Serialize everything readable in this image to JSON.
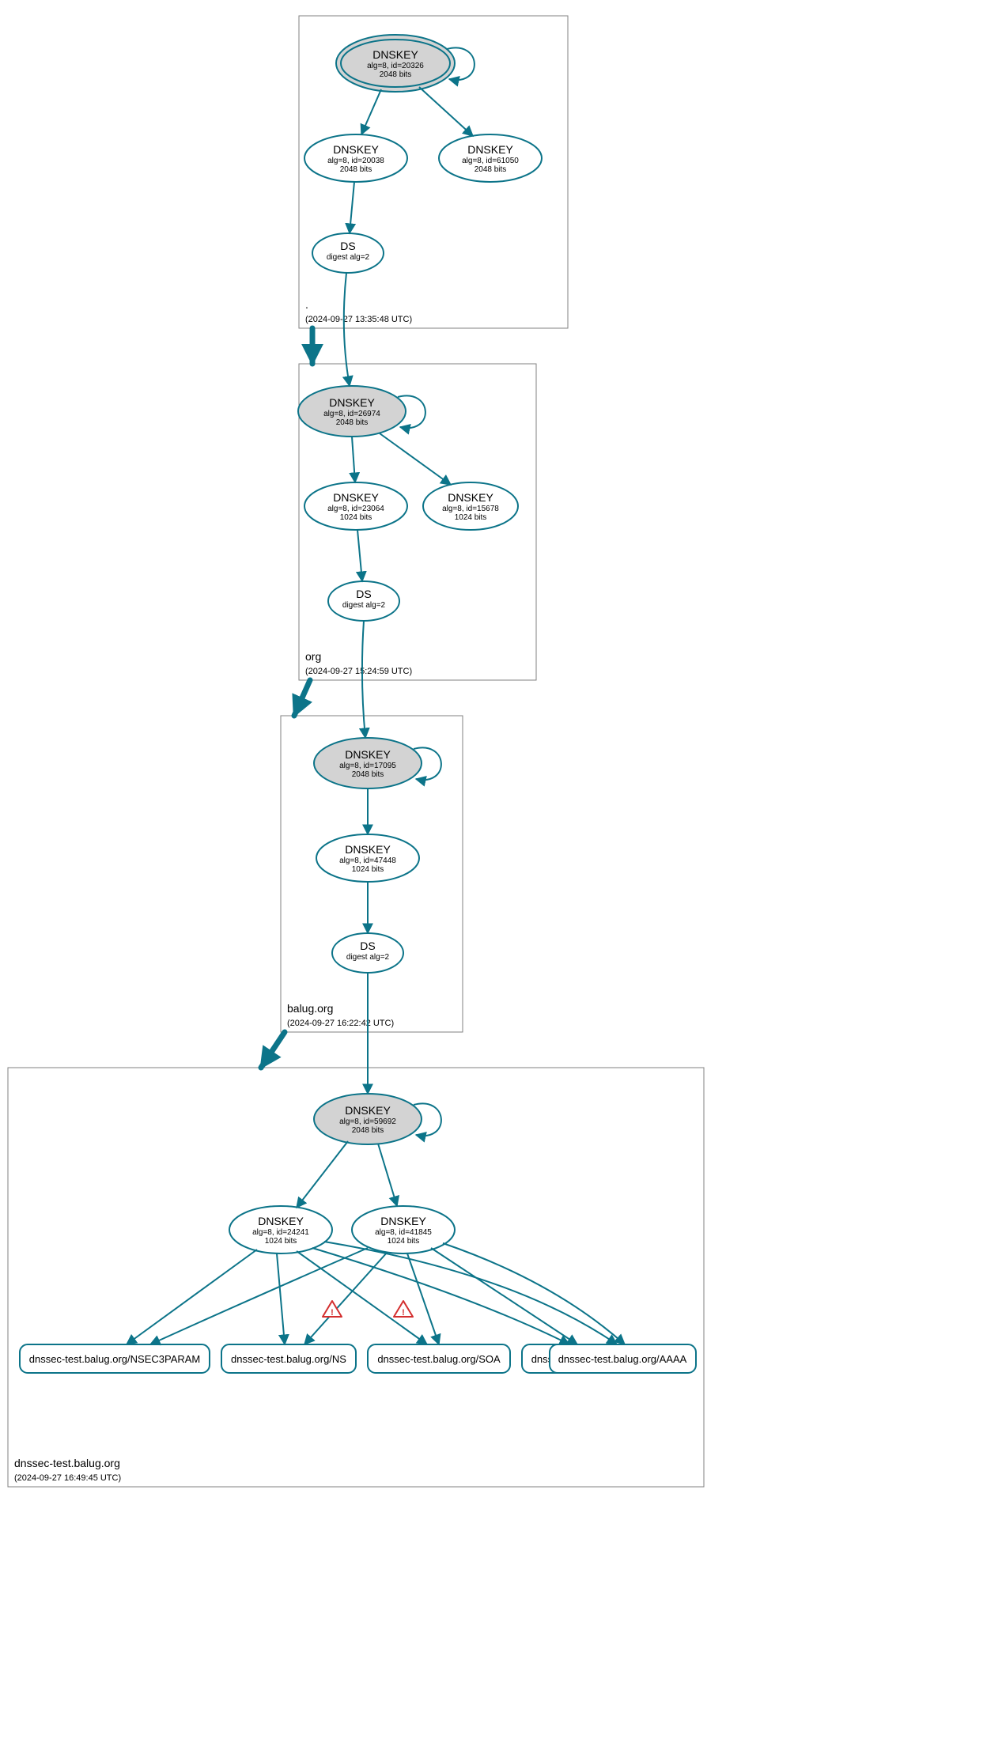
{
  "zones": {
    "root": {
      "label": ".",
      "timestamp": "(2024-09-27 13:35:48 UTC)",
      "keys": {
        "ksk": {
          "title": "DNSKEY",
          "line1": "alg=8, id=20326",
          "line2": "2048 bits"
        },
        "zsk1": {
          "title": "DNSKEY",
          "line1": "alg=8, id=20038",
          "line2": "2048 bits"
        },
        "zsk2": {
          "title": "DNSKEY",
          "line1": "alg=8, id=61050",
          "line2": "2048 bits"
        }
      },
      "ds": {
        "title": "DS",
        "line1": "digest alg=2"
      }
    },
    "org": {
      "label": "org",
      "timestamp": "(2024-09-27 15:24:59 UTC)",
      "keys": {
        "ksk": {
          "title": "DNSKEY",
          "line1": "alg=8, id=26974",
          "line2": "2048 bits"
        },
        "zsk1": {
          "title": "DNSKEY",
          "line1": "alg=8, id=23064",
          "line2": "1024 bits"
        },
        "zsk2": {
          "title": "DNSKEY",
          "line1": "alg=8, id=15678",
          "line2": "1024 bits"
        }
      },
      "ds": {
        "title": "DS",
        "line1": "digest alg=2"
      }
    },
    "balug": {
      "label": "balug.org",
      "timestamp": "(2024-09-27 16:22:42 UTC)",
      "keys": {
        "ksk": {
          "title": "DNSKEY",
          "line1": "alg=8, id=17095",
          "line2": "2048 bits"
        },
        "zsk": {
          "title": "DNSKEY",
          "line1": "alg=8, id=47448",
          "line2": "1024 bits"
        }
      },
      "ds": {
        "title": "DS",
        "line1": "digest alg=2"
      }
    },
    "dnssectest": {
      "label": "dnssec-test.balug.org",
      "timestamp": "(2024-09-27 16:49:45 UTC)",
      "keys": {
        "ksk": {
          "title": "DNSKEY",
          "line1": "alg=8, id=59692",
          "line2": "2048 bits"
        },
        "zsk1": {
          "title": "DNSKEY",
          "line1": "alg=8, id=24241",
          "line2": "1024 bits"
        },
        "zsk2": {
          "title": "DNSKEY",
          "line1": "alg=8, id=41845",
          "line2": "1024 bits"
        }
      },
      "rrsets": {
        "nsec3param": "dnssec-test.balug.org/NSEC3PARAM",
        "ns": "dnssec-test.balug.org/NS",
        "soa": "dnssec-test.balug.org/SOA",
        "a": "dnssec-test.balug.org/A",
        "aaaa": "dnssec-test.balug.org/AAAA"
      }
    }
  }
}
